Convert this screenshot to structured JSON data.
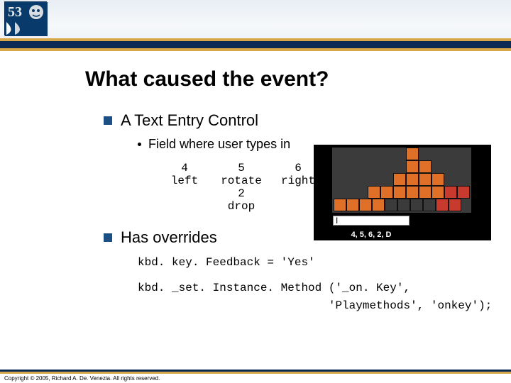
{
  "title": "What caused the event?",
  "bullets": [
    {
      "text": "A Text Entry Control"
    },
    {
      "text": "Has overrides"
    }
  ],
  "sub": {
    "text": "Field where user types in"
  },
  "keys": {
    "r1": [
      "4",
      "5",
      "6"
    ],
    "r2": [
      "left",
      "rotate",
      "right"
    ],
    "r3": [
      "",
      "2",
      ""
    ],
    "r4": [
      "",
      "drop",
      ""
    ]
  },
  "code": {
    "line1": "kbd. key. Feedback = 'Yes'",
    "line2": "kbd. _set. Instance. Method ('_on. Key',\n                            'Playmethods', 'onkey');"
  },
  "inset": {
    "caption": "4, 5, 6, 2, D",
    "cursor": "I"
  },
  "copyright": "Copyright © 2005, Richard A. De. Venezia. All rights reserved."
}
